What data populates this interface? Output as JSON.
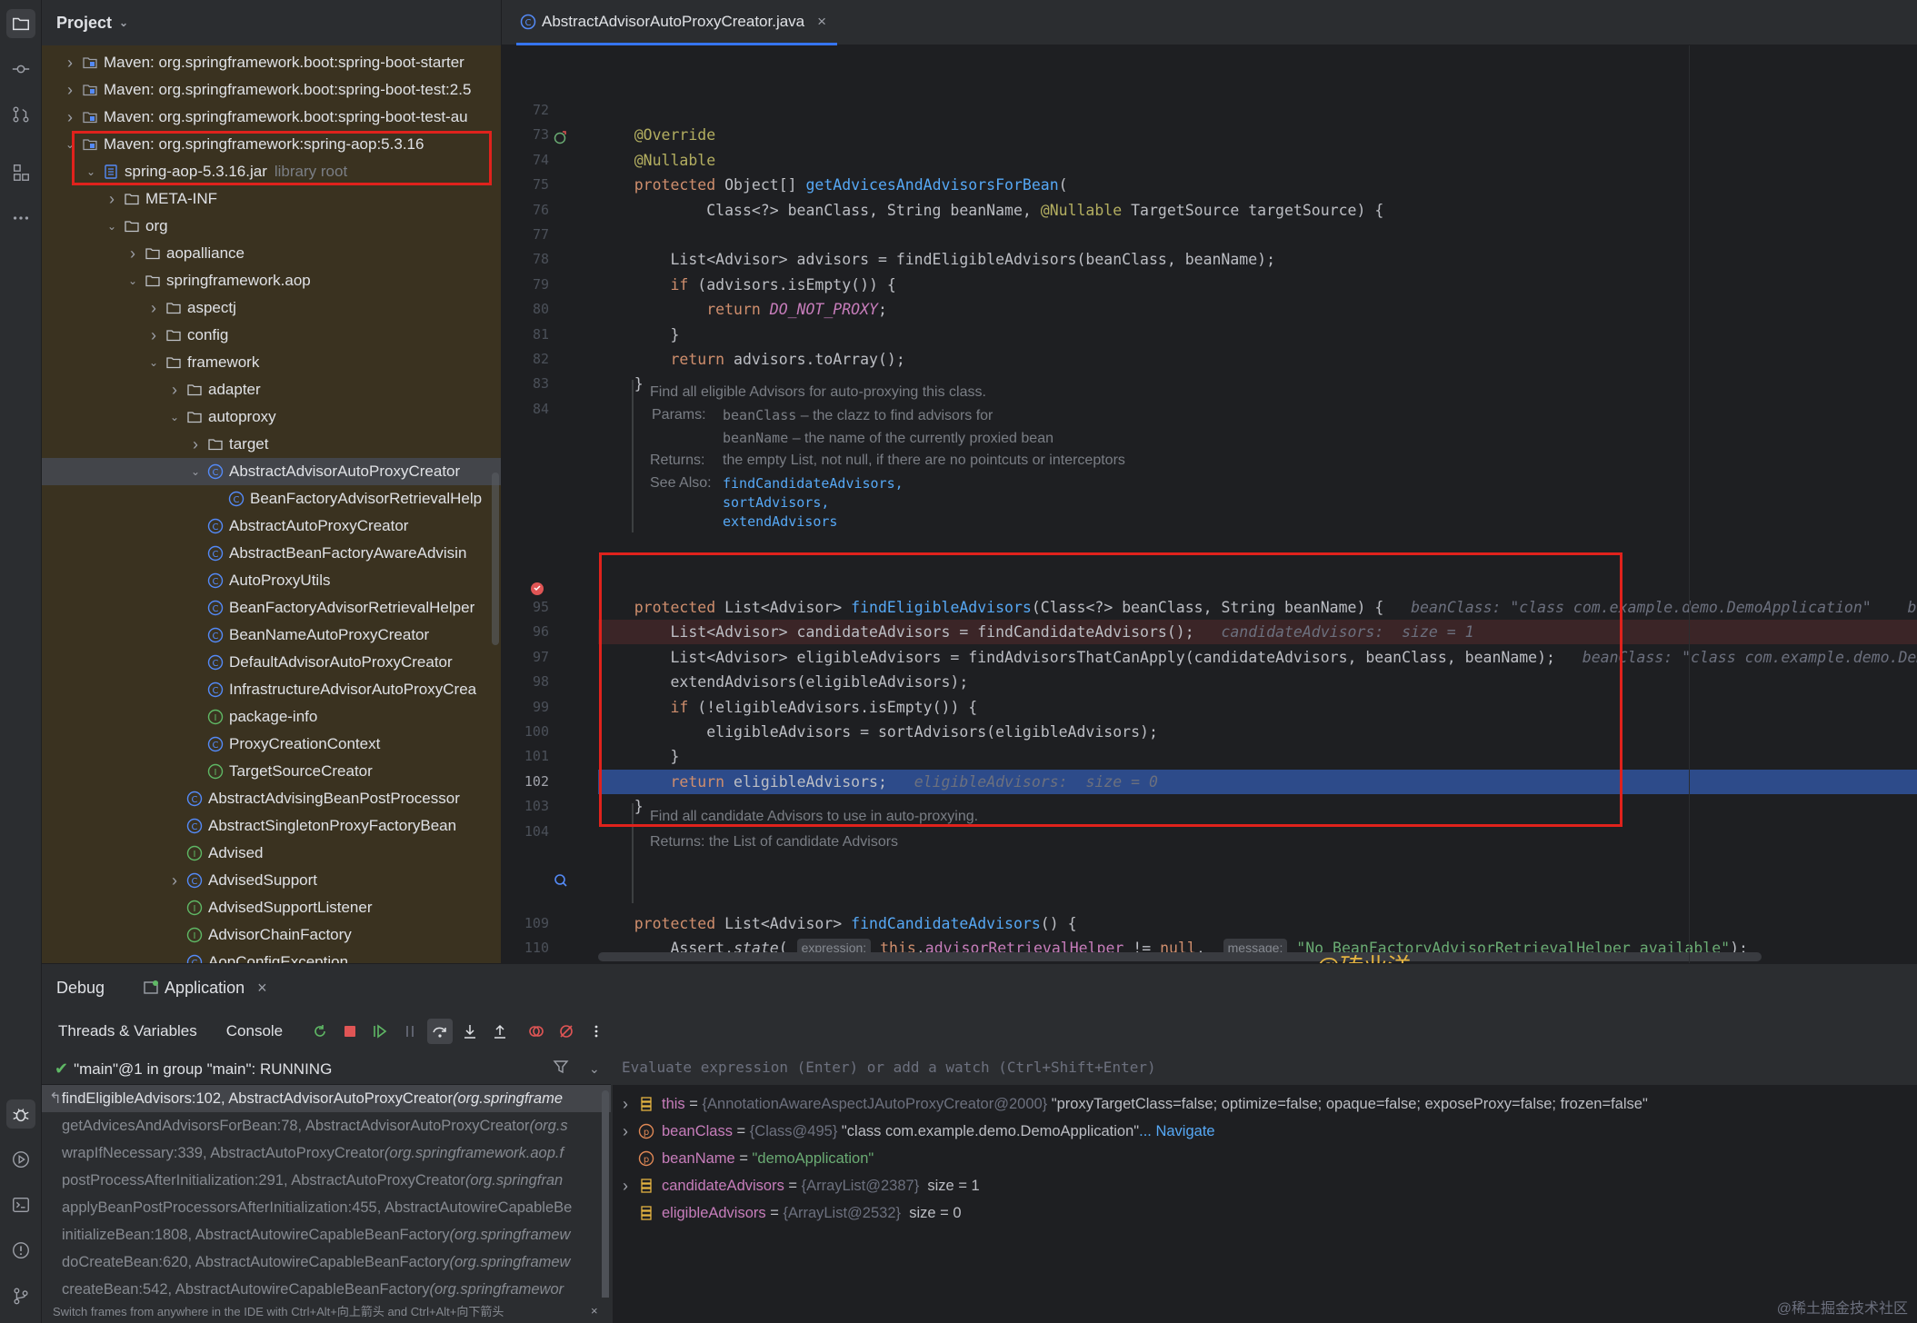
{
  "project": {
    "title": "Project",
    "tree": [
      {
        "depth": 0,
        "arrow": ">",
        "icon": "module",
        "label": "Maven: org.springframework.boot:spring-boot-starter"
      },
      {
        "depth": 0,
        "arrow": ">",
        "icon": "module",
        "label": "Maven: org.springframework.boot:spring-boot-test:2.5"
      },
      {
        "depth": 0,
        "arrow": ">",
        "icon": "module",
        "label": "Maven: org.springframework.boot:spring-boot-test-au"
      },
      {
        "depth": 0,
        "arrow": "v",
        "icon": "module",
        "label": "Maven: org.springframework:spring-aop:5.3.16"
      },
      {
        "depth": 1,
        "arrow": "v",
        "icon": "jar",
        "label": "spring-aop-5.3.16.jar",
        "dim": "library root"
      },
      {
        "depth": 2,
        "arrow": ">",
        "icon": "folder",
        "label": "META-INF"
      },
      {
        "depth": 2,
        "arrow": "v",
        "icon": "folder",
        "label": "org"
      },
      {
        "depth": 3,
        "arrow": ">",
        "icon": "folder",
        "label": "aopalliance"
      },
      {
        "depth": 3,
        "arrow": "v",
        "icon": "folder",
        "label": "springframework.aop"
      },
      {
        "depth": 4,
        "arrow": ">",
        "icon": "folder",
        "label": "aspectj"
      },
      {
        "depth": 4,
        "arrow": ">",
        "icon": "folder",
        "label": "config"
      },
      {
        "depth": 4,
        "arrow": "v",
        "icon": "folder",
        "label": "framework"
      },
      {
        "depth": 5,
        "arrow": ">",
        "icon": "folder",
        "label": "adapter"
      },
      {
        "depth": 5,
        "arrow": "v",
        "icon": "folder",
        "label": "autoproxy"
      },
      {
        "depth": 6,
        "arrow": ">",
        "icon": "folder",
        "label": "target"
      },
      {
        "depth": 6,
        "arrow": "v",
        "icon": "class",
        "label": "AbstractAdvisorAutoProxyCreator",
        "sel": true
      },
      {
        "depth": 7,
        "arrow": "",
        "icon": "class",
        "label": "BeanFactoryAdvisorRetrievalHelp"
      },
      {
        "depth": 6,
        "arrow": "",
        "icon": "class",
        "label": "AbstractAutoProxyCreator"
      },
      {
        "depth": 6,
        "arrow": "",
        "icon": "class",
        "label": "AbstractBeanFactoryAwareAdvisin"
      },
      {
        "depth": 6,
        "arrow": "",
        "icon": "class",
        "label": "AutoProxyUtils"
      },
      {
        "depth": 6,
        "arrow": "",
        "icon": "class",
        "label": "BeanFactoryAdvisorRetrievalHelper"
      },
      {
        "depth": 6,
        "arrow": "",
        "icon": "class",
        "label": "BeanNameAutoProxyCreator"
      },
      {
        "depth": 6,
        "arrow": "",
        "icon": "class",
        "label": "DefaultAdvisorAutoProxyCreator"
      },
      {
        "depth": 6,
        "arrow": "",
        "icon": "class",
        "label": "InfrastructureAdvisorAutoProxyCrea"
      },
      {
        "depth": 6,
        "arrow": "",
        "icon": "info",
        "label": "package-info"
      },
      {
        "depth": 6,
        "arrow": "",
        "icon": "class",
        "label": "ProxyCreationContext"
      },
      {
        "depth": 6,
        "arrow": "",
        "icon": "info",
        "label": "TargetSourceCreator"
      },
      {
        "depth": 5,
        "arrow": "",
        "icon": "class",
        "label": "AbstractAdvisingBeanPostProcessor"
      },
      {
        "depth": 5,
        "arrow": "",
        "icon": "class",
        "label": "AbstractSingletonProxyFactoryBean"
      },
      {
        "depth": 5,
        "arrow": "",
        "icon": "info",
        "label": "Advised"
      },
      {
        "depth": 5,
        "arrow": ">",
        "icon": "class",
        "label": "AdvisedSupport"
      },
      {
        "depth": 5,
        "arrow": "",
        "icon": "info",
        "label": "AdvisedSupportListener"
      },
      {
        "depth": 5,
        "arrow": "",
        "icon": "info",
        "label": "AdvisorChainFactory"
      },
      {
        "depth": 5,
        "arrow": "",
        "icon": "class",
        "label": "AopConfigException"
      }
    ]
  },
  "editor": {
    "tab": "AbstractAdvisorAutoProxyCreator.java",
    "doc1": {
      "summary": "Find all eligible Advisors for auto-proxying this class.",
      "params_label": "Params:",
      "p1_name": "beanClass",
      "p1_text": " – the clazz to find advisors for",
      "p2_name": "beanName",
      "p2_text": " – the name of the currently proxied bean",
      "returns_label": "Returns:",
      "returns_text": "the empty List, not null, if there are no pointcuts or interceptors",
      "see_label": "See Also:",
      "see1": "findCandidateAdvisors,",
      "see2": "sortAdvisors,",
      "see3": "extendAdvisors"
    },
    "doc2": {
      "summary": "Find all candidate Advisors to use in auto-proxying.",
      "returns": "Returns: the List of candidate Advisors"
    },
    "current_line": "102",
    "watermark": "@砖业洋__"
  },
  "debug": {
    "tab_debug": "Debug",
    "tab_app": "Application",
    "threads_label": "Threads & Variables",
    "console_label": "Console",
    "thread": "\"main\"@1 in group \"main\": RUNNING",
    "frames": [
      {
        "m": "findEligibleAdvisors:102, AbstractAdvisorAutoProxyCreator ",
        "p": "(org.springframe"
      },
      {
        "m": "getAdvicesAndAdvisorsForBean:78, AbstractAdvisorAutoProxyCreator ",
        "p": "(org.s"
      },
      {
        "m": "wrapIfNecessary:339, AbstractAutoProxyCreator ",
        "p": "(org.springframework.aop.f"
      },
      {
        "m": "postProcessAfterInitialization:291, AbstractAutoProxyCreator ",
        "p": "(org.springfran"
      },
      {
        "m": "applyBeanPostProcessorsAfterInitialization:455, AbstractAutowireCapableBe",
        "p": ""
      },
      {
        "m": "initializeBean:1808, AbstractAutowireCapableBeanFactory ",
        "p": "(org.springframew"
      },
      {
        "m": "doCreateBean:620, AbstractAutowireCapableBeanFactory ",
        "p": "(org.springframew"
      },
      {
        "m": "createBean:542, AbstractAutowireCapableBeanFactory ",
        "p": "(org.springframewor"
      }
    ],
    "status": "Switch frames from anywhere in the IDE with Ctrl+Alt+向上箭头 and Ctrl+Alt+向下箭头",
    "eval_placeholder": "Evaluate expression (Enter) or add a watch (Ctrl+Shift+Enter)",
    "vars": [
      {
        "arrow": ">",
        "icon": "field",
        "name": "this",
        "eq": " = ",
        "ref": "{AnnotationAwareAspectJAutoProxyCreator@2000}",
        "val": " \"proxyTargetClass=false; optimize=false; opaque=false; exposeProxy=false; frozen=false\"",
        "nav": ""
      },
      {
        "arrow": ">",
        "icon": "param",
        "name": "beanClass",
        "eq": " = ",
        "ref": "{Class@495}",
        "val": " \"class com.example.demo.DemoApplication\"",
        "nav": " ... Navigate"
      },
      {
        "arrow": "",
        "icon": "param",
        "name": "beanName",
        "eq": " = ",
        "ref": "",
        "val": "\"demoApplication\"",
        "nav": ""
      },
      {
        "arrow": ">",
        "icon": "field",
        "name": "candidateAdvisors",
        "eq": " = ",
        "ref": "{ArrayList@2387}",
        "val": "  size = 1",
        "nav": ""
      },
      {
        "arrow": "",
        "icon": "field",
        "name": "eligibleAdvisors",
        "eq": " = ",
        "ref": "{ArrayList@2532}",
        "val": "  size = 0",
        "nav": ""
      }
    ]
  },
  "footer_watermark": "@稀土掘金技术社区"
}
